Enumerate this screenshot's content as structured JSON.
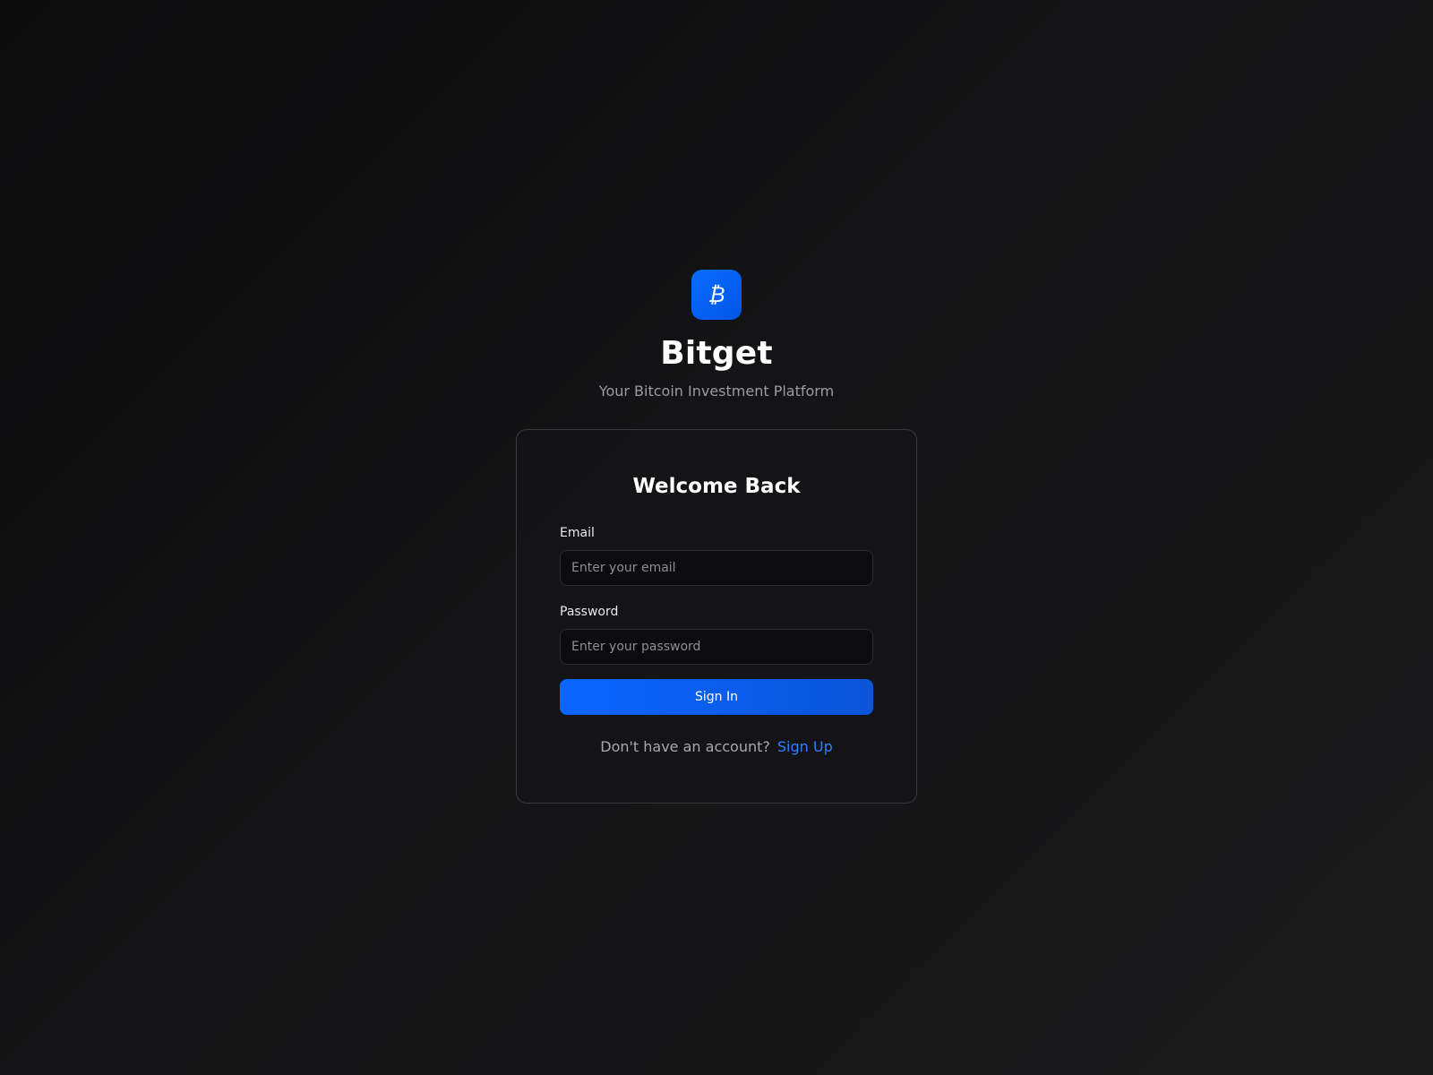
{
  "brand": {
    "name": "Bitget",
    "tagline": "Your Bitcoin Investment Platform",
    "logo_icon": "bitcoin-icon",
    "accent_color": "#0a66ff"
  },
  "login_card": {
    "title": "Welcome Back",
    "email": {
      "label": "Email",
      "placeholder": "Enter your email",
      "value": ""
    },
    "password": {
      "label": "Password",
      "placeholder": "Enter your password",
      "value": ""
    },
    "submit_label": "Sign In",
    "signup_prompt": "Don't have an account?",
    "signup_link": "Sign Up"
  }
}
